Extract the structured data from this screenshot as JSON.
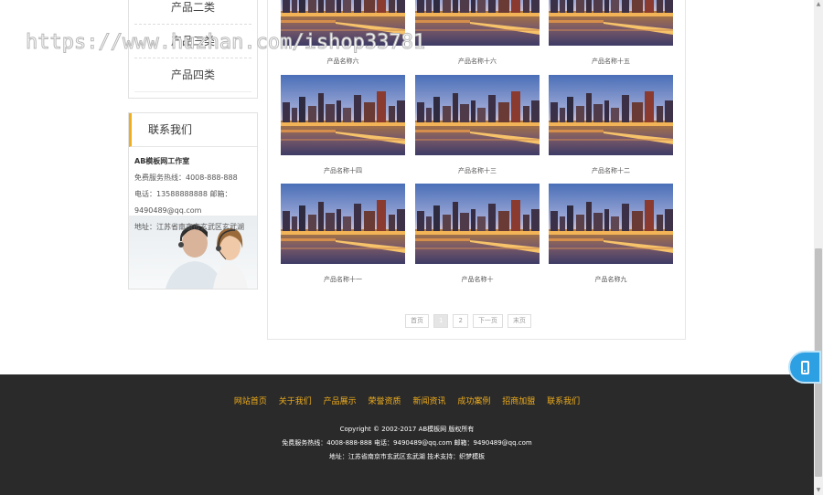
{
  "watermark": "https://www.huzhan.com/ishop33781",
  "sidebar": {
    "categories": [
      "产品二类",
      "产品三类",
      "产品四类"
    ],
    "contact": {
      "title": "联系我们",
      "company": "AB模板网工作室",
      "hotline": "免费服务热线：4008-888-888",
      "phone_email": "电话：13588888888 邮箱：",
      "email": "9490489@qq.com",
      "address": "地址：江苏省南京市玄武区玄武湖"
    }
  },
  "products": [
    "产品名称六",
    "产品名称十六",
    "产品名称十五",
    "产品名称十四",
    "产品名称十三",
    "产品名称十二",
    "产品名称十一",
    "产品名称十",
    "产品名称九"
  ],
  "pager": [
    "首页",
    "1",
    "2",
    "下一页",
    "末页"
  ],
  "footer": {
    "nav": [
      "网站首页",
      "关于我们",
      "产品展示",
      "荣誉资质",
      "新闻资讯",
      "成功案例",
      "招商加盟",
      "联系我们"
    ],
    "copyright": "Copyright © 2002-2017 AB模板网 版权所有",
    "contact_line": "免费服务热线：4008-888-888 电话：9490489@qq.com 邮箱：9490489@qq.com",
    "address_line": "地址：江苏省南京市玄武区玄武湖 技术支持：织梦模板"
  },
  "colors": {
    "accent": "#f0ad1c",
    "footer_bg": "#2a2a2a",
    "float_button": "#2d9fe3"
  },
  "icons": {
    "float_button": "mobile-phone-icon"
  }
}
